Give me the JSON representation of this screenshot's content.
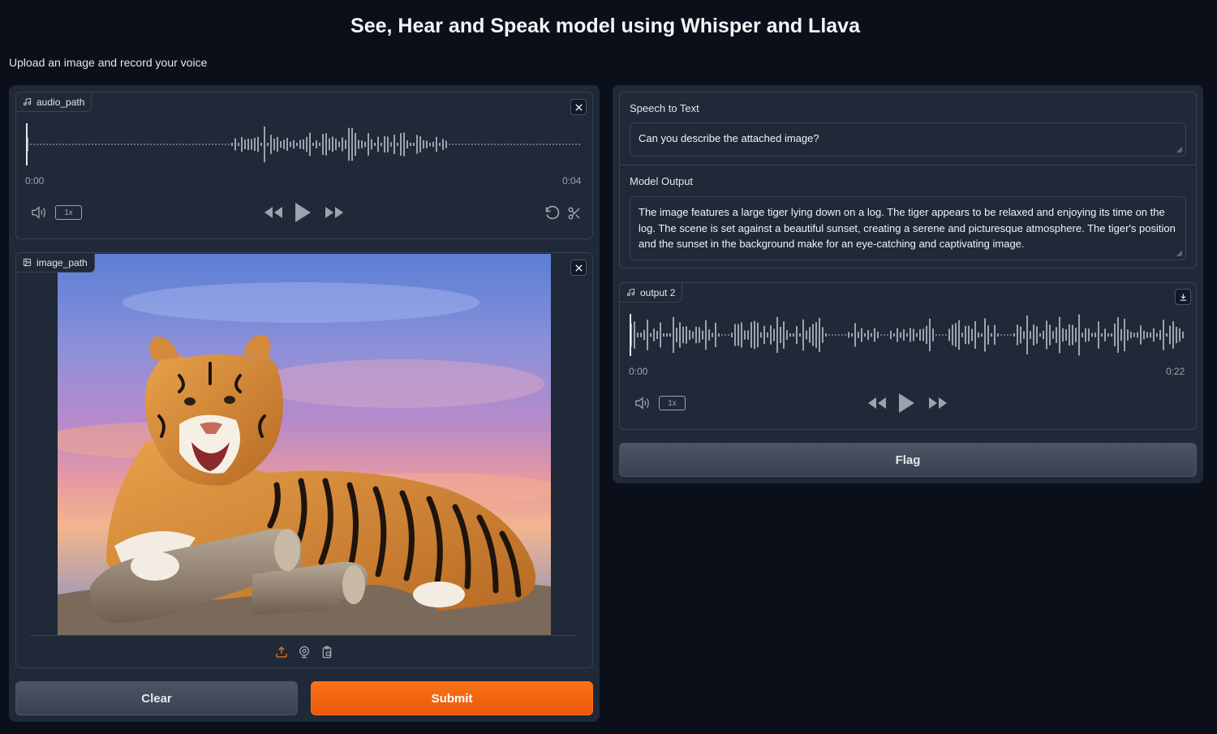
{
  "header": {
    "title": "See, Hear and Speak model using Whisper and Llava",
    "subtitle": "Upload an image and record your voice"
  },
  "audio_input": {
    "label": "audio_path",
    "time_start": "0:00",
    "time_end": "0:04",
    "speed": "1x"
  },
  "image_input": {
    "label": "image_path"
  },
  "buttons": {
    "clear": "Clear",
    "submit": "Submit",
    "flag": "Flag"
  },
  "speech_to_text": {
    "label": "Speech to Text",
    "value": "Can you describe the attached image?"
  },
  "model_output": {
    "label": "Model Output",
    "value": "The image features a large tiger lying down on a log. The tiger appears to be relaxed and enjoying its time on the log. The scene is set against a beautiful sunset, creating a serene and picturesque atmosphere. The tiger's position and the sunset in the background make for an eye-catching and captivating image."
  },
  "audio_output": {
    "label": "output 2",
    "time_start": "0:00",
    "time_end": "0:22",
    "speed": "1x"
  },
  "colors": {
    "background": "#0b0f19",
    "panel": "#1f2937",
    "border": "#374151",
    "primary": "#f97316",
    "waveform": "#9ca3af"
  },
  "icons": {
    "audio_label": "music-note-icon",
    "image_label": "image-icon",
    "clear_x": "close-icon",
    "volume": "volume-icon",
    "rewind": "rewind-icon",
    "play": "play-icon",
    "forward": "fast-forward-icon",
    "undo": "undo-icon",
    "trim": "scissors-icon",
    "upload": "upload-icon",
    "webcam": "webcam-icon",
    "clipboard": "clipboard-icon",
    "download": "download-icon"
  }
}
